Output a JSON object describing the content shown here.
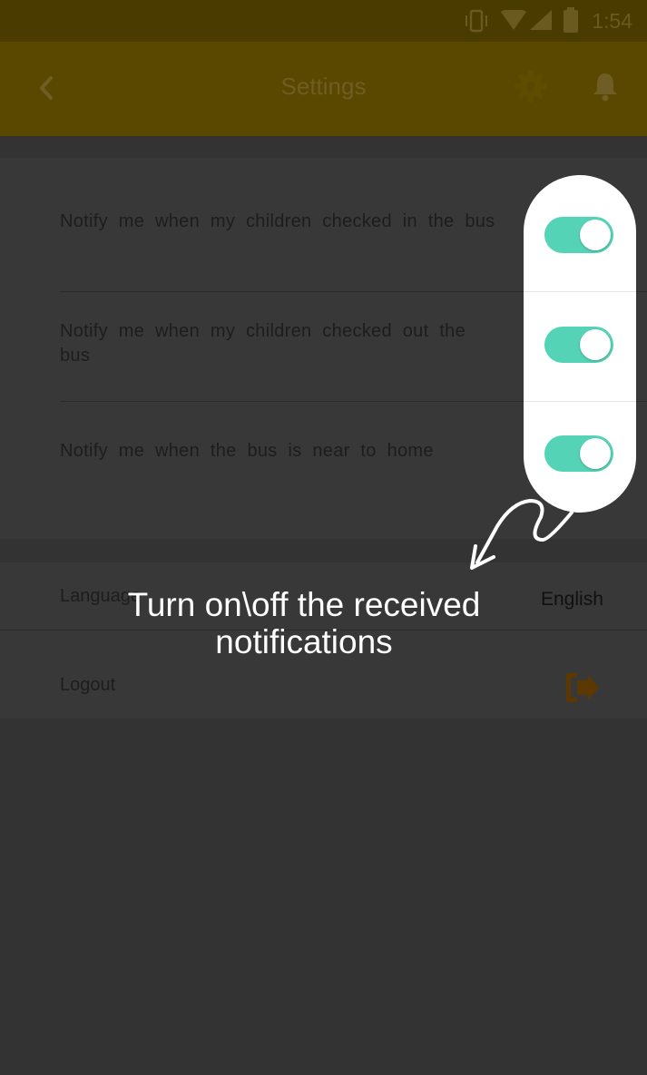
{
  "status_bar": {
    "time": "1:54"
  },
  "app_bar": {
    "title": "Settings"
  },
  "notifications": [
    {
      "label": "Notify me when my children checked in the bus",
      "enabled": true
    },
    {
      "label": "Notify me when my children checked out the bus",
      "enabled": true
    },
    {
      "label": "Notify me when the bus is near to home",
      "enabled": true
    }
  ],
  "language": {
    "label": "Language",
    "value": "English"
  },
  "logout": {
    "label": "Logout"
  },
  "overlay": {
    "hint": "Turn on\\off the received notifications"
  },
  "colors": {
    "accent_dim": "#5a4700",
    "toggle_on": "#54d3b6",
    "overlay_bg": "#333334",
    "logout_icon": "#5c3800"
  },
  "icons": [
    "back-arrow-icon",
    "gear-icon",
    "bell-icon",
    "vibrate-icon",
    "wifi-icon",
    "signal-icon",
    "battery-icon",
    "logout-icon"
  ]
}
